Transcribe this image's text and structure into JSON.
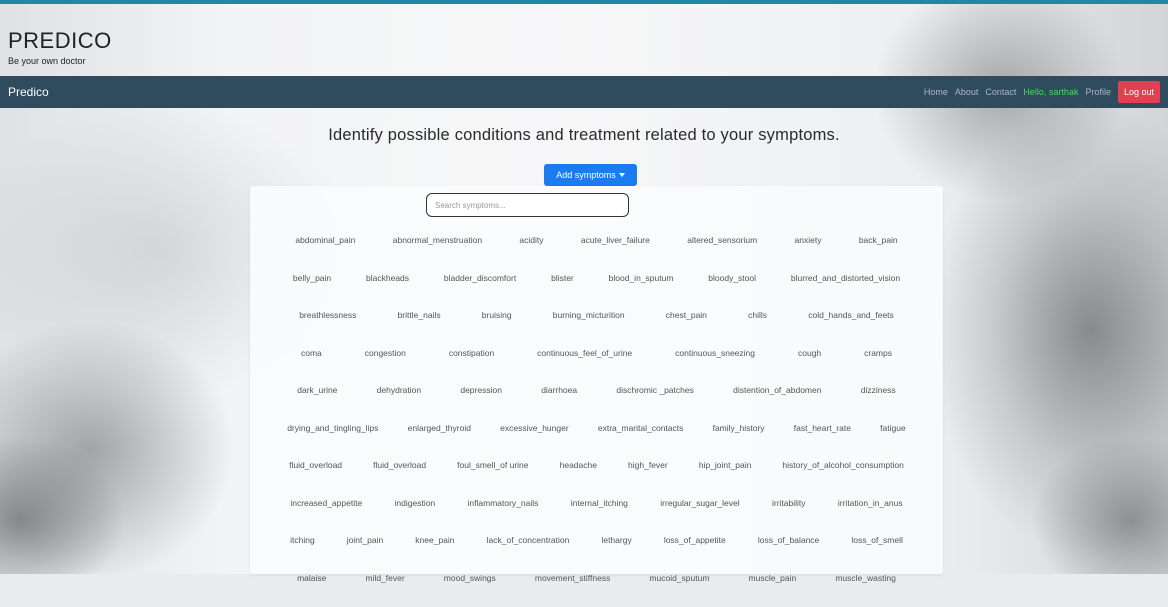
{
  "brand": {
    "title": "PREDICO",
    "tagline": "Be your own doctor"
  },
  "navbar": {
    "brand": "Predico",
    "links": [
      "Home",
      "About",
      "Contact"
    ],
    "user": "Hello, sarthak",
    "profile": "Profile",
    "logout": "Log out"
  },
  "main": {
    "headline": "Identify possible conditions and treatment related to your symptoms.",
    "add_button": "Add symptoms",
    "search_placeholder": "Search symptoms..."
  },
  "symptom_rows": [
    [
      "abdominal_pain",
      "abnormal_menstruation",
      "acidity",
      "acute_liver_failure",
      "altered_sensorium",
      "anxiety",
      "back_pain"
    ],
    [
      "belly_pain",
      "blackheads",
      "bladder_discomfort",
      "blister",
      "blood_in_sputum",
      "bloody_stool",
      "blurred_and_distorted_vision"
    ],
    [
      "breathlessness",
      "brittle_nails",
      "bruising",
      "burning_micturition",
      "chest_pain",
      "chills",
      "cold_hands_and_feets"
    ],
    [
      "coma",
      "congestion",
      "constipation",
      "continuous_feel_of_urine",
      "continuous_sneezing",
      "cough",
      "cramps"
    ],
    [
      "dark_urine",
      "dehydration",
      "depression",
      "diarrhoea",
      "dischromic _patches",
      "distention_of_abdomen",
      "dizziness"
    ],
    [
      "drying_and_tingling_lips",
      "enlarged_thyroid",
      "excessive_hunger",
      "extra_marital_contacts",
      "family_history",
      "fast_heart_rate",
      "fatigue"
    ],
    [
      "fluid_overload",
      "fluid_overload",
      "foul_smell_of urine",
      "headache",
      "high_fever",
      "hip_joint_pain",
      "history_of_alcohol_consumption"
    ],
    [
      "increased_appetite",
      "indigestion",
      "inflammatory_nails",
      "internal_itching",
      "irregular_sugar_level",
      "irritability",
      "irritation_in_anus"
    ],
    [
      "itching",
      "joint_pain",
      "knee_pain",
      "lack_of_concentration",
      "lethargy",
      "loss_of_appetite",
      "loss_of_balance",
      "loss_of_smell"
    ],
    [
      "malaise",
      "mild_fever",
      "mood_swings",
      "movement_stiffness",
      "mucoid_sputum",
      "muscle_pain",
      "muscle_wasting"
    ]
  ],
  "colors": {
    "navbar": "#2f4b5e",
    "logout": "#e04050",
    "add_button": "#1a7cf0",
    "user_text": "#4cd964"
  }
}
